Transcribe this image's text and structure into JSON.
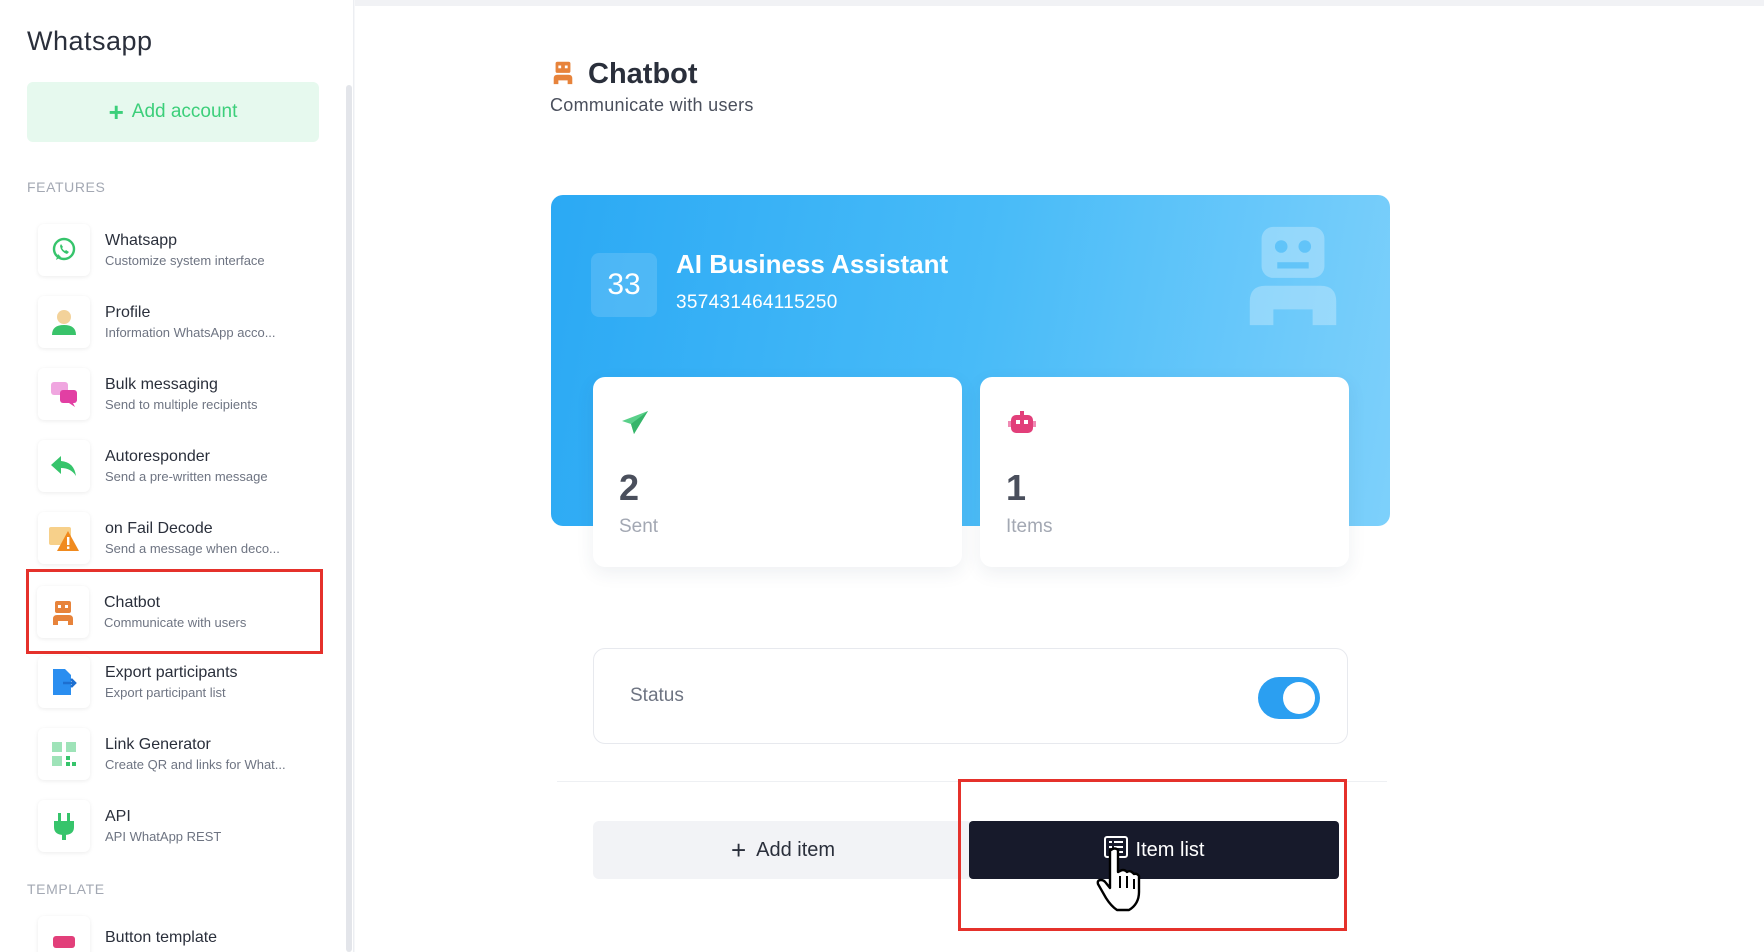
{
  "app": {
    "title": "Whatsapp"
  },
  "sidebar": {
    "add_account_label": "Add account",
    "sections": {
      "features": "FEATURES",
      "template": "TEMPLATE"
    },
    "items": [
      {
        "label": "Whatsapp",
        "desc": "Customize system interface",
        "icon": "whatsapp-icon"
      },
      {
        "label": "Profile",
        "desc": "Information WhatsApp acco...",
        "icon": "profile-icon"
      },
      {
        "label": "Bulk messaging",
        "desc": "Send to multiple recipients",
        "icon": "chat-bubbles-icon"
      },
      {
        "label": "Autoresponder",
        "desc": "Send a pre-written message",
        "icon": "reply-icon"
      },
      {
        "label": "on Fail Decode",
        "desc": "Send a message when deco...",
        "icon": "warning-icon"
      },
      {
        "label": "Chatbot",
        "desc": "Communicate with users",
        "icon": "robot-icon",
        "active": true
      },
      {
        "label": "Export participants",
        "desc": "Export participant list",
        "icon": "export-icon"
      },
      {
        "label": "Link Generator",
        "desc": "Create QR and links for What...",
        "icon": "qr-icon"
      },
      {
        "label": "API",
        "desc": "API WhatApp REST",
        "icon": "plug-icon"
      },
      {
        "label": "Button template",
        "desc": "",
        "icon": "button-template-icon"
      }
    ]
  },
  "page": {
    "title": "Chatbot",
    "subtitle": "Communicate with users"
  },
  "hero": {
    "badge": "33",
    "name": "AI Business Assistant",
    "phone": "357431464115250"
  },
  "stats": [
    {
      "value": "2",
      "label": "Sent",
      "icon": "paper-plane-icon"
    },
    {
      "value": "1",
      "label": "Items",
      "icon": "robot-icon"
    }
  ],
  "status": {
    "label": "Status",
    "enabled": true
  },
  "actions": {
    "add_item": "Add item",
    "item_list": "Item list"
  },
  "colors": {
    "accent": "#2b9ff1",
    "green": "#3ccf7a",
    "dark": "#171a2b",
    "highlight": "#e5312b"
  }
}
